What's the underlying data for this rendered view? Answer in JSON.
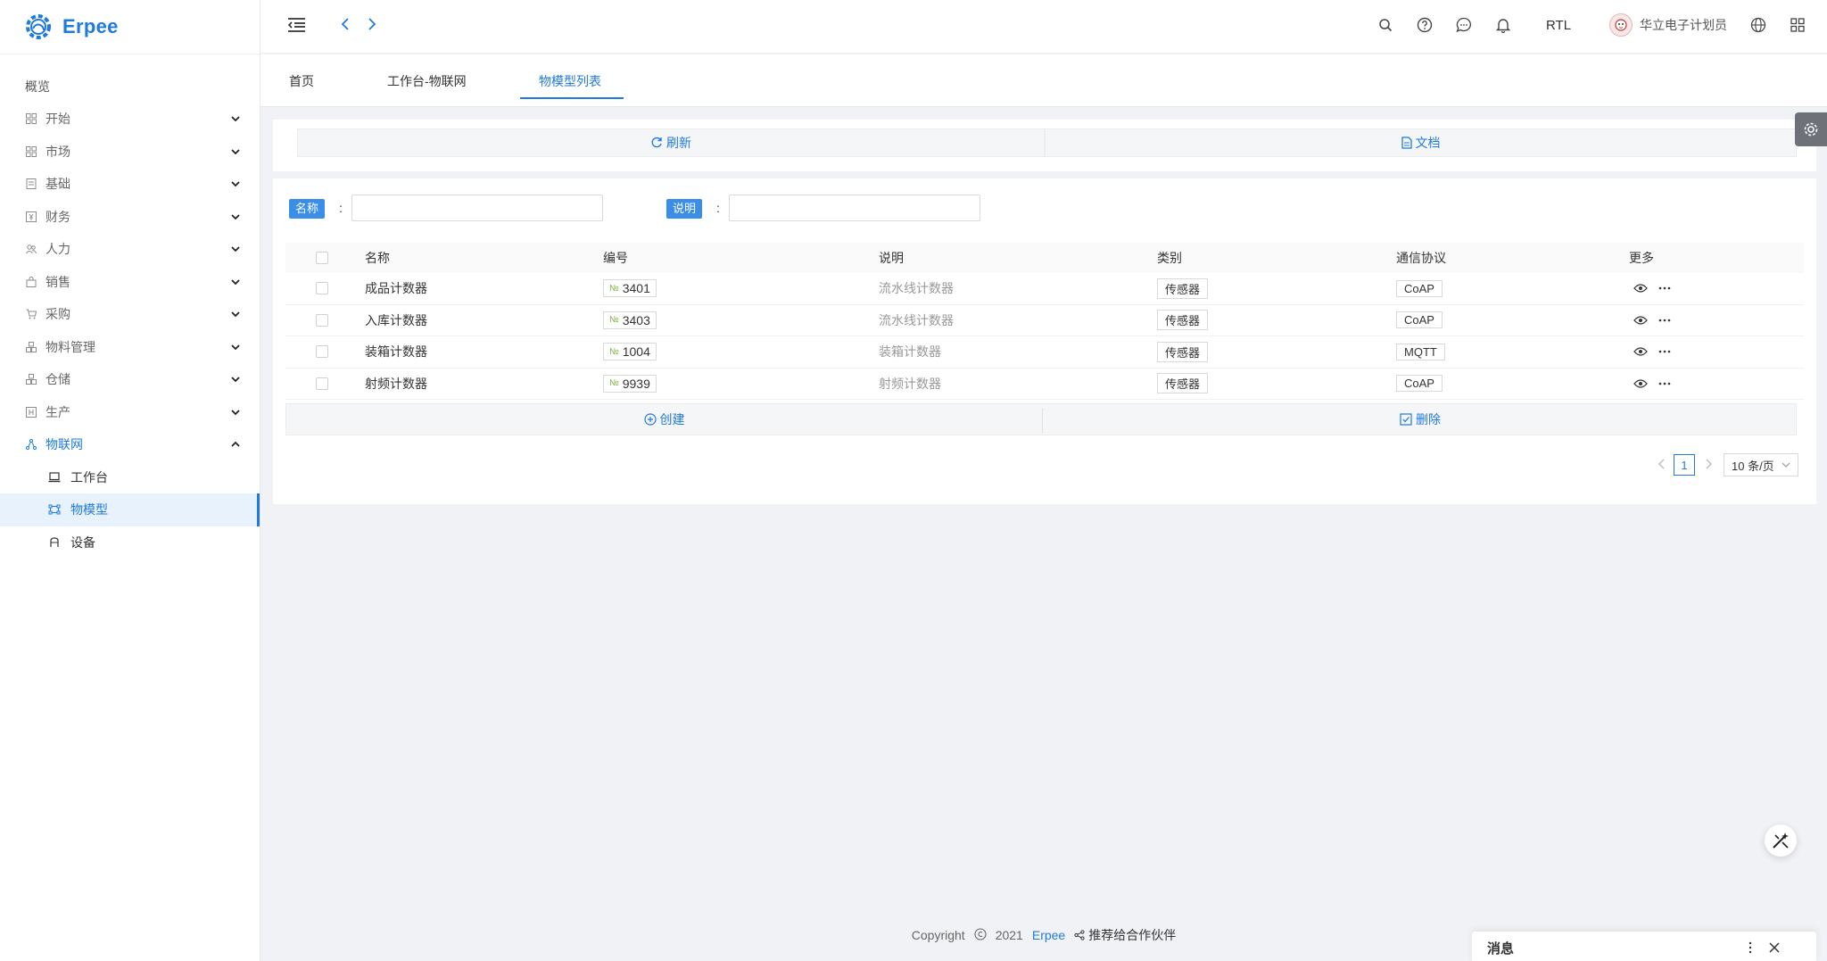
{
  "app": {
    "name": "Erpee"
  },
  "sidebar": {
    "overview": "概览",
    "menu": [
      {
        "label": "开始",
        "icon": "grid-icon"
      },
      {
        "label": "市场",
        "icon": "grid-icon"
      },
      {
        "label": "基础",
        "icon": "doc-icon"
      },
      {
        "label": "财务",
        "icon": "finance-icon"
      },
      {
        "label": "人力",
        "icon": "people-icon"
      },
      {
        "label": "销售",
        "icon": "bag-icon"
      },
      {
        "label": "采购",
        "icon": "cart-icon"
      },
      {
        "label": "物料管理",
        "icon": "boxes-icon"
      },
      {
        "label": "仓储",
        "icon": "warehouse-icon"
      },
      {
        "label": "生产",
        "icon": "factory-icon"
      },
      {
        "label": "物联网",
        "icon": "iot-icon"
      }
    ],
    "submenu": [
      {
        "label": "工作台",
        "icon": "laptop-icon"
      },
      {
        "label": "物模型",
        "icon": "model-icon"
      },
      {
        "label": "设备",
        "icon": "device-icon"
      }
    ]
  },
  "header": {
    "rtl": "RTL",
    "user": "华立电子计划员"
  },
  "tabs": [
    "首页",
    "工作台-物联网",
    "物模型列表"
  ],
  "toolbar": {
    "refresh": "刷新",
    "docs": "文档"
  },
  "filters": {
    "name_label": "名称",
    "desc_label": "说明",
    "colon": ":"
  },
  "table": {
    "columns": [
      "名称",
      "编号",
      "说明",
      "类别",
      "通信协议",
      "更多"
    ],
    "rows": [
      {
        "name": "成品计数器",
        "code": "3401",
        "desc": "流水线计数器",
        "category": "传感器",
        "protocol": "CoAP"
      },
      {
        "name": "入库计数器",
        "code": "3403",
        "desc": "流水线计数器",
        "category": "传感器",
        "protocol": "CoAP"
      },
      {
        "name": "装箱计数器",
        "code": "1004",
        "desc": "装箱计数器",
        "category": "传感器",
        "protocol": "MQTT"
      },
      {
        "name": "射频计数器",
        "code": "9939",
        "desc": "射频计数器",
        "category": "传感器",
        "protocol": "CoAP"
      }
    ],
    "code_prefix": "№",
    "create": "创建",
    "delete": "删除"
  },
  "pagination": {
    "current": "1",
    "page_size": "10 条/页"
  },
  "footer": {
    "copyright": "Copyright",
    "year": "2021",
    "brand": "Erpee",
    "partner": "推荐给合作伙伴"
  },
  "messages": {
    "title": "消息"
  },
  "colors": {
    "accent": "#1f7ae0",
    "tag": "#3b8ee8"
  }
}
